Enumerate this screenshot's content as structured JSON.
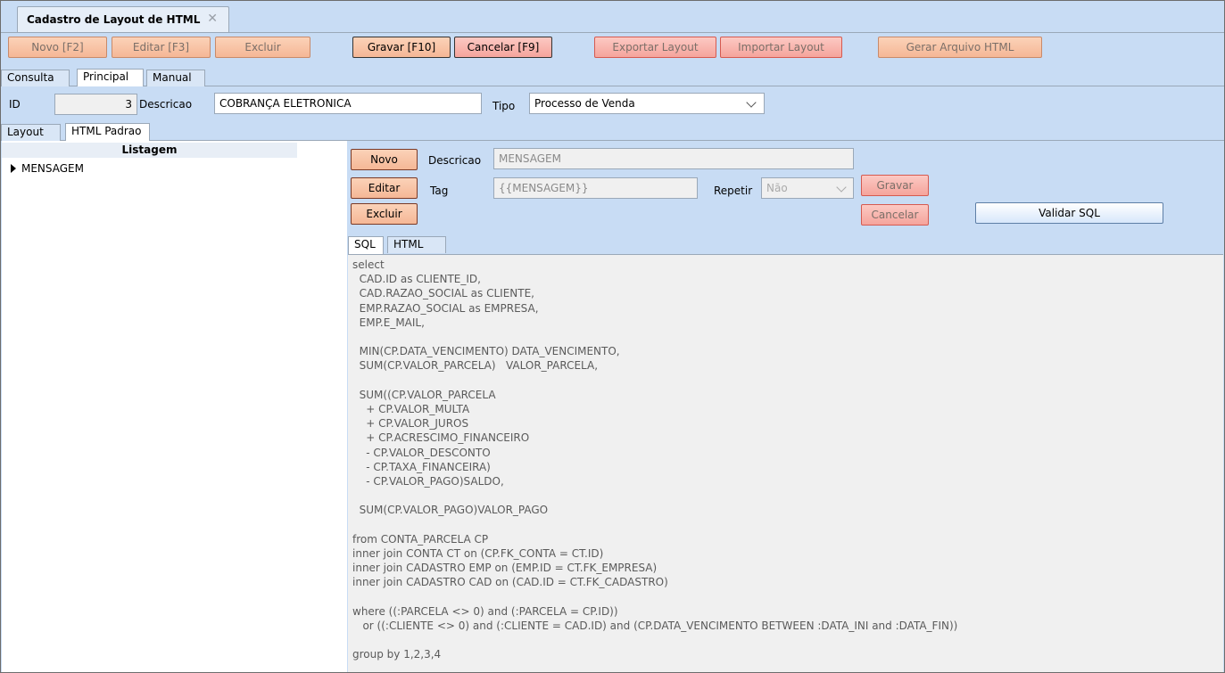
{
  "window": {
    "tab_title": "Cadastro de Layout de HTML",
    "close_glyph": "✕"
  },
  "toolbar": {
    "novo": "Novo [F2]",
    "editar": "Editar [F3]",
    "excluir": "Excluir",
    "gravar": "Gravar [F10]",
    "cancelar": "Cancelar [F9]",
    "exportar": "Exportar Layout",
    "importar": "Importar Layout",
    "gerar": "Gerar Arquivo HTML"
  },
  "main_tabs": [
    "Consulta",
    "Principal",
    "Manual"
  ],
  "form": {
    "id_label": "ID",
    "id_value": "3",
    "descricao_label": "Descricao",
    "descricao_value": "COBRANÇA ELETRONICA",
    "tipo_label": "Tipo",
    "tipo_value": "Processo de Venda"
  },
  "sub_tabs": [
    "Layout",
    "HTML Padrao"
  ],
  "listagem": {
    "header": "Listagem",
    "rows": [
      "MENSAGEM"
    ]
  },
  "detail": {
    "novo": "Novo",
    "editar": "Editar",
    "excluir": "Excluir",
    "descricao_label": "Descricao",
    "descricao_value": "MENSAGEM",
    "tag_label": "Tag",
    "tag_value": "{{MENSAGEM}}",
    "repetir_label": "Repetir",
    "repetir_value": "Não",
    "gravar": "Gravar",
    "cancelar": "Cancelar",
    "validar": "Validar SQL"
  },
  "editor_tabs": [
    "SQL",
    "HTML"
  ],
  "sql_text": "select\n  CAD.ID as CLIENTE_ID,\n  CAD.RAZAO_SOCIAL as CLIENTE,\n  EMP.RAZAO_SOCIAL as EMPRESA,\n  EMP.E_MAIL,\n\n  MIN(CP.DATA_VENCIMENTO) DATA_VENCIMENTO,\n  SUM(CP.VALOR_PARCELA)   VALOR_PARCELA,\n\n  SUM((CP.VALOR_PARCELA\n    + CP.VALOR_MULTA\n    + CP.VALOR_JUROS\n    + CP.ACRESCIMO_FINANCEIRO\n    - CP.VALOR_DESCONTO\n    - CP.TAXA_FINANCEIRA)\n    - CP.VALOR_PAGO)SALDO,\n\n  SUM(CP.VALOR_PAGO)VALOR_PAGO\n\nfrom CONTA_PARCELA CP\ninner join CONTA CT on (CP.FK_CONTA = CT.ID)\ninner join CADASTRO EMP on (EMP.ID = CT.FK_EMPRESA)\ninner join CADASTRO CAD on (CAD.ID = CT.FK_CADASTRO)\n\nwhere ((:PARCELA <> 0) and (:PARCELA = CP.ID))\n   or ((:CLIENTE <> 0) and (:CLIENTE = CAD.ID) and (CP.DATA_VENCIMENTO BETWEEN :DATA_INI and :DATA_FIN))\n\ngroup by 1,2,3,4"
}
